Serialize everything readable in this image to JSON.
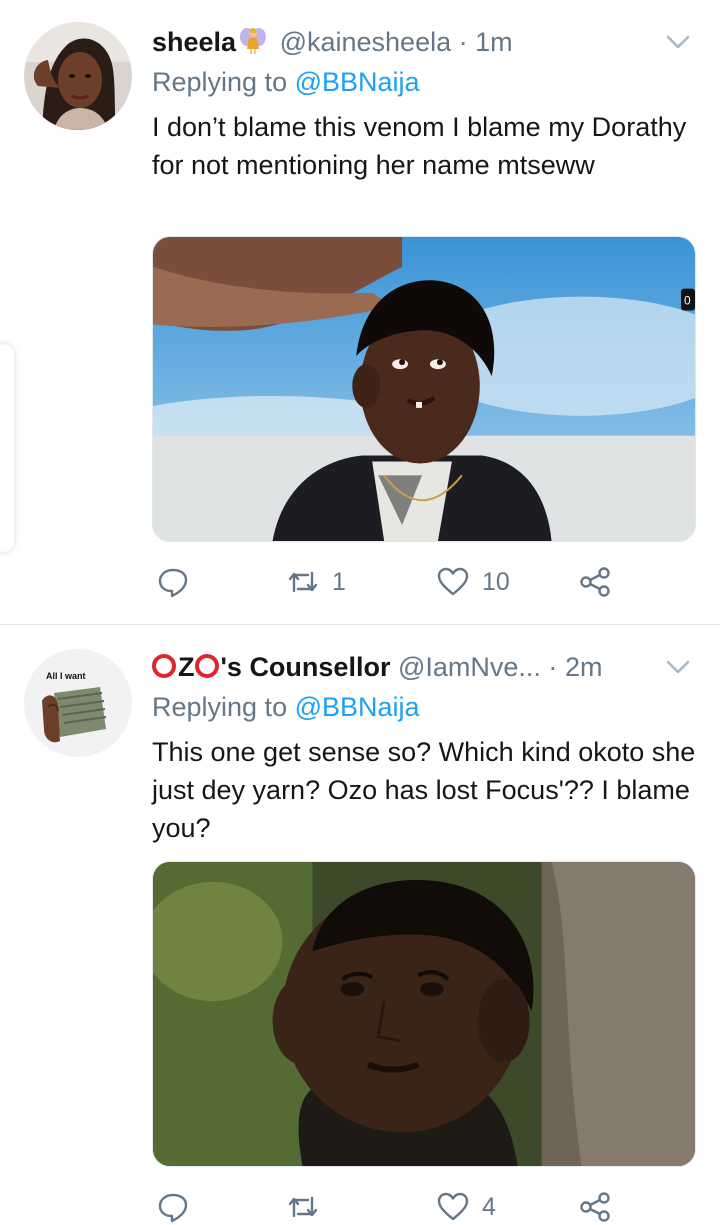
{
  "tweets": [
    {
      "display_name": "sheela",
      "emoji": "fairy-emoji",
      "handle": "@kainesheela",
      "separator": "·",
      "time": "1m",
      "replying_prefix": "Replying to",
      "replying_to": "@BBNaija",
      "text": "I don’t blame this venom I blame my Dorathy for not mentioning her name mtseww",
      "media_badge": "0",
      "counts": {
        "replies": "",
        "retweets": "1",
        "likes": "10"
      }
    },
    {
      "display_name_prefix": "Z",
      "display_name": "'s Counsellor",
      "handle": "@IamNve...",
      "separator": "·",
      "time": "2m",
      "replying_prefix": "Replying to",
      "replying_to": "@BBNaija",
      "text": "This one get sense so? Which kind okoto she just dey yarn? Ozo has lost Focus'?? I blame you?",
      "avatar_caption": "All I want",
      "counts": {
        "replies": "",
        "retweets": "",
        "likes": "4"
      }
    }
  ],
  "icons": {
    "more": "chevron-down-icon",
    "reply": "reply-icon",
    "retweet": "retweet-icon",
    "like": "heart-icon",
    "share": "share-icon"
  },
  "colors": {
    "mention": "#1da1f2",
    "muted": "#657786",
    "text": "#14171a",
    "ozo_red": "#e0262d"
  }
}
